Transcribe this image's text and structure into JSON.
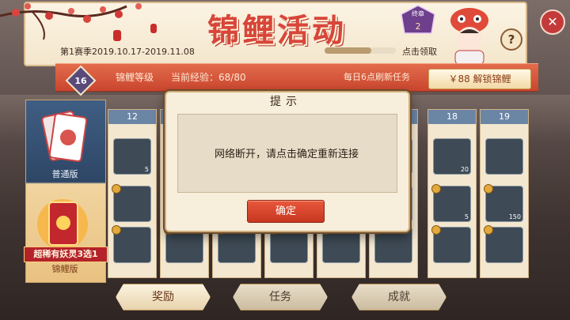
{
  "banner": {
    "title": "锦鲤活动",
    "season_text": "第1赛季2019.10.17-2019.11.08",
    "claim_text": "点击领取",
    "badge_text": "终章",
    "badge_number": "2",
    "progress_fraction": 0.65
  },
  "level_bar": {
    "level": "16",
    "level_label": "锦鲤等级",
    "exp_label": "当前经验：68/80",
    "refresh_label": "每日6点刷新任务",
    "unlock_button": "￥88 解锁锦鲤"
  },
  "left_panel": {
    "normal_label": "普通版",
    "rare_banner": "超稀有妖灵3选1",
    "koi_label": "锦鲤版"
  },
  "columns": [
    {
      "level": "12",
      "top_count": "5",
      "bottom_counts": [
        "",
        ""
      ]
    },
    {
      "level": "",
      "top_count": "",
      "bottom_counts": [
        "",
        ""
      ]
    },
    {
      "level": "",
      "top_count": "",
      "bottom_counts": [
        "",
        ""
      ]
    },
    {
      "level": "",
      "top_count": "",
      "bottom_counts": [
        "",
        ""
      ]
    },
    {
      "level": "",
      "top_count": "",
      "bottom_counts": [
        "",
        ""
      ]
    },
    {
      "level": "",
      "top_count": "",
      "bottom_counts": [
        "",
        ""
      ]
    },
    {
      "level": "18",
      "top_count": "20",
      "bottom_counts": [
        "5",
        ""
      ]
    },
    {
      "level": "19",
      "top_count": "",
      "bottom_counts": [
        "150",
        ""
      ]
    }
  ],
  "dialog": {
    "title": "提示",
    "message": "网络断开，请点击确定重新连接",
    "ok_button": "确定"
  },
  "tabs": {
    "rewards": "奖励",
    "tasks": "任务",
    "achievements": "成就"
  },
  "colors": {
    "accent_red": "#d8453a",
    "level_bar": "#c9452e",
    "column_header": "#6b85a5"
  }
}
